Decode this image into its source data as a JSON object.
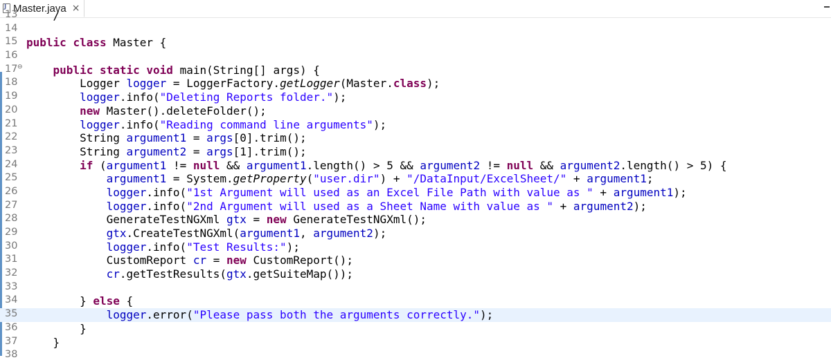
{
  "window": {
    "tab_title": "Master.java",
    "tab_close_glyph": "×",
    "icons": {
      "tab": "java-file-icon",
      "close": "close-icon",
      "minimize": "minimize-icon",
      "fold": "collapse-icon"
    }
  },
  "colors": {
    "keyword": "#7f0055",
    "string": "#2a00ff",
    "field": "#0000c0",
    "line_number": "#787878",
    "current_line_bg": "#e8f2fe",
    "change_bar": "#5f92c6"
  },
  "editor": {
    "current_line": "35",
    "lines": [
      {
        "n": "13",
        "tokens": [
          {
            "t": "    /",
            "c": "pln"
          }
        ]
      },
      {
        "n": "14",
        "tokens": []
      },
      {
        "n": "15",
        "tokens": [
          {
            "t": "public ",
            "c": "kw"
          },
          {
            "t": "class ",
            "c": "kw"
          },
          {
            "t": "Master {",
            "c": "pln"
          }
        ]
      },
      {
        "n": "16",
        "tokens": []
      },
      {
        "n": "17",
        "fold": "⊖",
        "tokens": [
          {
            "t": "    ",
            "c": "pln"
          },
          {
            "t": "public ",
            "c": "kw"
          },
          {
            "t": "static ",
            "c": "kw"
          },
          {
            "t": "void ",
            "c": "kw"
          },
          {
            "t": "main(String[] args) {",
            "c": "pln"
          }
        ]
      },
      {
        "n": "18",
        "tokens": [
          {
            "t": "        Logger ",
            "c": "pln"
          },
          {
            "t": "logger",
            "c": "fld"
          },
          {
            "t": " = LoggerFactory.",
            "c": "pln"
          },
          {
            "t": "getLogger",
            "c": "stat"
          },
          {
            "t": "(Master.",
            "c": "pln"
          },
          {
            "t": "class",
            "c": "kw"
          },
          {
            "t": ");",
            "c": "pln"
          }
        ]
      },
      {
        "n": "19",
        "tokens": [
          {
            "t": "        ",
            "c": "pln"
          },
          {
            "t": "logger",
            "c": "fld"
          },
          {
            "t": ".info(",
            "c": "pln"
          },
          {
            "t": "\"Deleting Reports folder.\"",
            "c": "str"
          },
          {
            "t": ");",
            "c": "pln"
          }
        ]
      },
      {
        "n": "20",
        "tokens": [
          {
            "t": "        ",
            "c": "pln"
          },
          {
            "t": "new ",
            "c": "kw"
          },
          {
            "t": "Master().deleteFolder();",
            "c": "pln"
          }
        ]
      },
      {
        "n": "21",
        "tokens": [
          {
            "t": "        ",
            "c": "pln"
          },
          {
            "t": "logger",
            "c": "fld"
          },
          {
            "t": ".info(",
            "c": "pln"
          },
          {
            "t": "\"Reading command line arguments\"",
            "c": "str"
          },
          {
            "t": ");",
            "c": "pln"
          }
        ]
      },
      {
        "n": "22",
        "tokens": [
          {
            "t": "        String ",
            "c": "pln"
          },
          {
            "t": "argument1",
            "c": "fld"
          },
          {
            "t": " = ",
            "c": "pln"
          },
          {
            "t": "args",
            "c": "fld"
          },
          {
            "t": "[0].trim();",
            "c": "pln"
          }
        ]
      },
      {
        "n": "23",
        "tokens": [
          {
            "t": "        String ",
            "c": "pln"
          },
          {
            "t": "argument2",
            "c": "fld"
          },
          {
            "t": " = ",
            "c": "pln"
          },
          {
            "t": "args",
            "c": "fld"
          },
          {
            "t": "[1].trim();",
            "c": "pln"
          }
        ]
      },
      {
        "n": "24",
        "tokens": [
          {
            "t": "        ",
            "c": "pln"
          },
          {
            "t": "if ",
            "c": "kw"
          },
          {
            "t": "(",
            "c": "pln"
          },
          {
            "t": "argument1",
            "c": "fld"
          },
          {
            "t": " != ",
            "c": "pln"
          },
          {
            "t": "null",
            "c": "kw"
          },
          {
            "t": " && ",
            "c": "pln"
          },
          {
            "t": "argument1",
            "c": "fld"
          },
          {
            "t": ".length() > 5 && ",
            "c": "pln"
          },
          {
            "t": "argument2",
            "c": "fld"
          },
          {
            "t": " != ",
            "c": "pln"
          },
          {
            "t": "null",
            "c": "kw"
          },
          {
            "t": " && ",
            "c": "pln"
          },
          {
            "t": "argument2",
            "c": "fld"
          },
          {
            "t": ".length() > 5) {",
            "c": "pln"
          }
        ]
      },
      {
        "n": "25",
        "tokens": [
          {
            "t": "            ",
            "c": "pln"
          },
          {
            "t": "argument1",
            "c": "fld"
          },
          {
            "t": " = System.",
            "c": "pln"
          },
          {
            "t": "getProperty",
            "c": "stat"
          },
          {
            "t": "(",
            "c": "pln"
          },
          {
            "t": "\"user.dir\"",
            "c": "str"
          },
          {
            "t": ") + ",
            "c": "pln"
          },
          {
            "t": "\"/DataInput/ExcelSheet/\"",
            "c": "str"
          },
          {
            "t": " + ",
            "c": "pln"
          },
          {
            "t": "argument1",
            "c": "fld"
          },
          {
            "t": ";",
            "c": "pln"
          }
        ]
      },
      {
        "n": "26",
        "tokens": [
          {
            "t": "            ",
            "c": "pln"
          },
          {
            "t": "logger",
            "c": "fld"
          },
          {
            "t": ".info(",
            "c": "pln"
          },
          {
            "t": "\"1st Argument will used as an Excel File Path with value as \"",
            "c": "str"
          },
          {
            "t": " + ",
            "c": "pln"
          },
          {
            "t": "argument1",
            "c": "fld"
          },
          {
            "t": ");",
            "c": "pln"
          }
        ]
      },
      {
        "n": "27",
        "tokens": [
          {
            "t": "            ",
            "c": "pln"
          },
          {
            "t": "logger",
            "c": "fld"
          },
          {
            "t": ".info(",
            "c": "pln"
          },
          {
            "t": "\"2nd Argument will used as a Sheet Name with value as \"",
            "c": "str"
          },
          {
            "t": " + ",
            "c": "pln"
          },
          {
            "t": "argument2",
            "c": "fld"
          },
          {
            "t": ");",
            "c": "pln"
          }
        ]
      },
      {
        "n": "28",
        "tokens": [
          {
            "t": "            GenerateTestNGXml ",
            "c": "pln"
          },
          {
            "t": "gtx",
            "c": "fld"
          },
          {
            "t": " = ",
            "c": "pln"
          },
          {
            "t": "new ",
            "c": "kw"
          },
          {
            "t": "GenerateTestNGXml();",
            "c": "pln"
          }
        ]
      },
      {
        "n": "29",
        "tokens": [
          {
            "t": "            ",
            "c": "pln"
          },
          {
            "t": "gtx",
            "c": "fld"
          },
          {
            "t": ".CreateTestNGXml(",
            "c": "pln"
          },
          {
            "t": "argument1",
            "c": "fld"
          },
          {
            "t": ", ",
            "c": "pln"
          },
          {
            "t": "argument2",
            "c": "fld"
          },
          {
            "t": ");",
            "c": "pln"
          }
        ]
      },
      {
        "n": "30",
        "tokens": [
          {
            "t": "            ",
            "c": "pln"
          },
          {
            "t": "logger",
            "c": "fld"
          },
          {
            "t": ".info(",
            "c": "pln"
          },
          {
            "t": "\"Test Results:\"",
            "c": "str"
          },
          {
            "t": ");",
            "c": "pln"
          }
        ]
      },
      {
        "n": "31",
        "tokens": [
          {
            "t": "            CustomReport ",
            "c": "pln"
          },
          {
            "t": "cr",
            "c": "fld"
          },
          {
            "t": " = ",
            "c": "pln"
          },
          {
            "t": "new ",
            "c": "kw"
          },
          {
            "t": "CustomReport();",
            "c": "pln"
          }
        ]
      },
      {
        "n": "32",
        "tokens": [
          {
            "t": "            ",
            "c": "pln"
          },
          {
            "t": "cr",
            "c": "fld"
          },
          {
            "t": ".getTestResults(",
            "c": "pln"
          },
          {
            "t": "gtx",
            "c": "fld"
          },
          {
            "t": ".getSuiteMap());",
            "c": "pln"
          }
        ]
      },
      {
        "n": "33",
        "tokens": []
      },
      {
        "n": "34",
        "tokens": [
          {
            "t": "        } ",
            "c": "pln"
          },
          {
            "t": "else ",
            "c": "kw"
          },
          {
            "t": "{",
            "c": "pln"
          }
        ]
      },
      {
        "n": "35",
        "tokens": [
          {
            "t": "            ",
            "c": "pln"
          },
          {
            "t": "logger",
            "c": "fld"
          },
          {
            "t": ".error(",
            "c": "pln"
          },
          {
            "t": "\"Please pass both the arguments correctly.\"",
            "c": "str"
          },
          {
            "t": ");",
            "c": "pln"
          }
        ]
      },
      {
        "n": "36",
        "tokens": [
          {
            "t": "        }",
            "c": "pln"
          }
        ]
      },
      {
        "n": "37",
        "tokens": [
          {
            "t": "    }",
            "c": "pln"
          }
        ]
      },
      {
        "n": "38",
        "tokens": []
      }
    ]
  }
}
